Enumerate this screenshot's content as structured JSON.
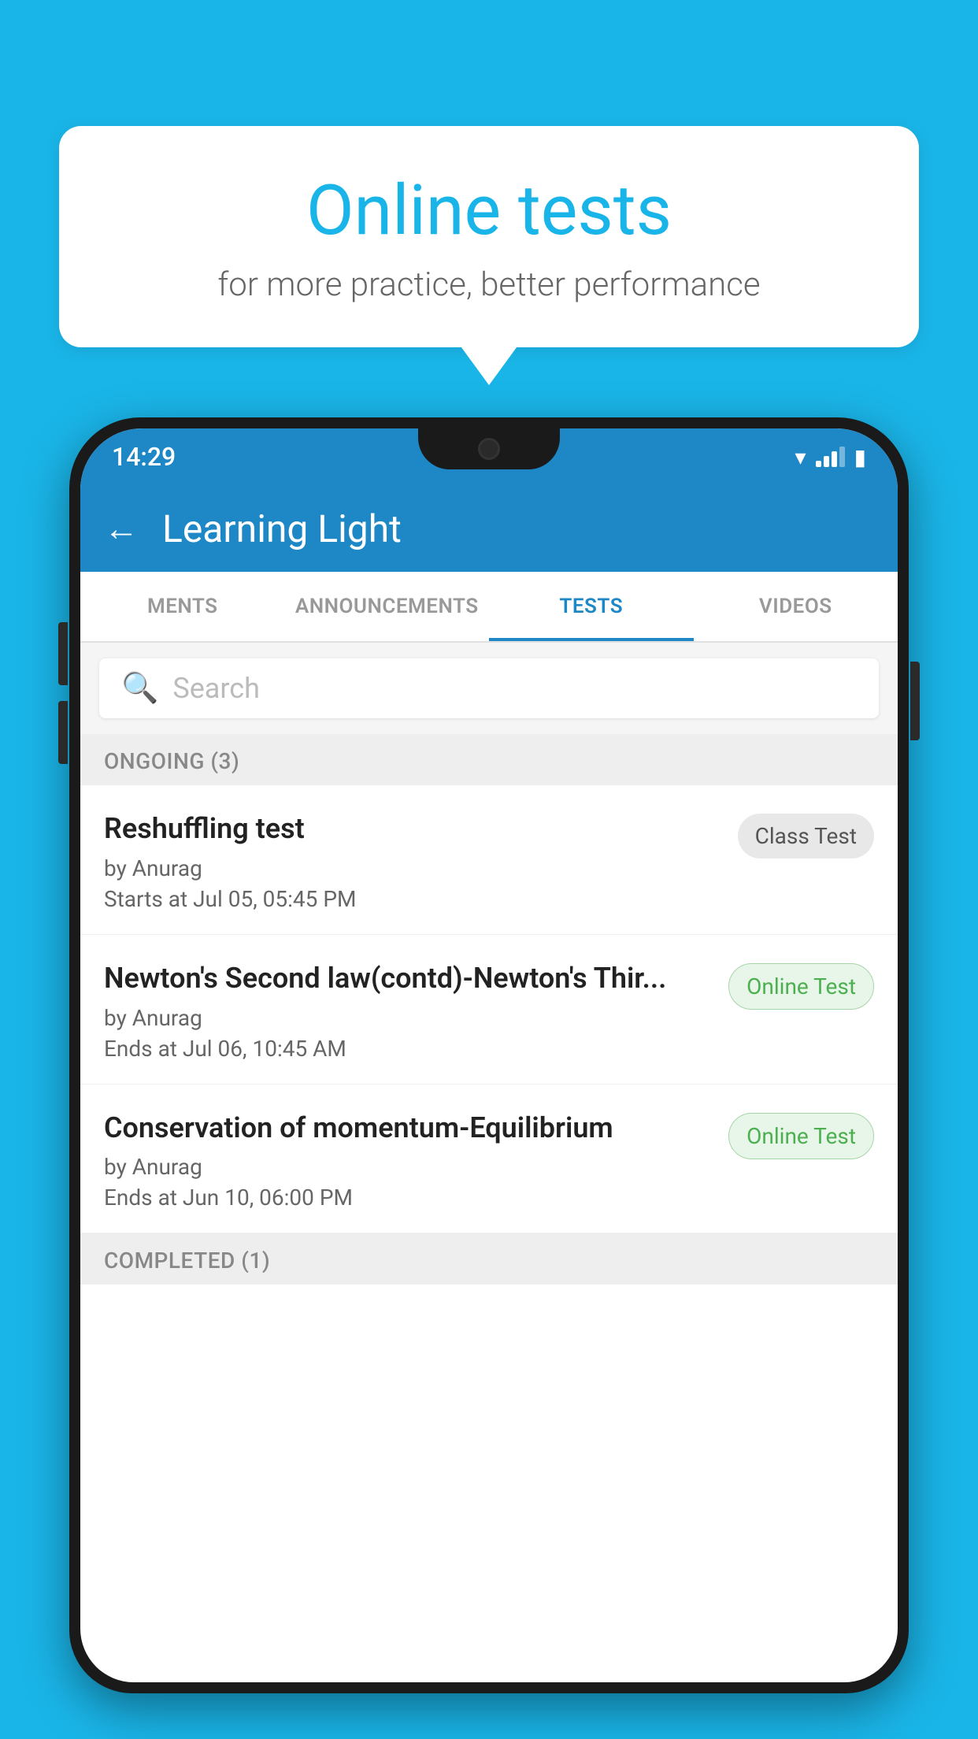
{
  "background_color": "#1ab5e8",
  "speech_bubble": {
    "title": "Online tests",
    "subtitle": "for more practice, better performance"
  },
  "phone": {
    "status_bar": {
      "time": "14:29"
    },
    "app_bar": {
      "title": "Learning Light",
      "back_label": "←"
    },
    "tabs": [
      {
        "label": "MENTS",
        "active": false
      },
      {
        "label": "ANNOUNCEMENTS",
        "active": false
      },
      {
        "label": "TESTS",
        "active": true
      },
      {
        "label": "VIDEOS",
        "active": false
      }
    ],
    "search": {
      "placeholder": "Search"
    },
    "ongoing_section": {
      "title": "ONGOING (3)"
    },
    "tests": [
      {
        "name": "Reshuffling test",
        "author": "by Anurag",
        "time_label": "Starts at",
        "time": "Jul 05, 05:45 PM",
        "badge": "Class Test",
        "badge_type": "class"
      },
      {
        "name": "Newton's Second law(contd)-Newton's Thir...",
        "author": "by Anurag",
        "time_label": "Ends at",
        "time": "Jul 06, 10:45 AM",
        "badge": "Online Test",
        "badge_type": "online"
      },
      {
        "name": "Conservation of momentum-Equilibrium",
        "author": "by Anurag",
        "time_label": "Ends at",
        "time": "Jun 10, 06:00 PM",
        "badge": "Online Test",
        "badge_type": "online"
      }
    ],
    "completed_section": {
      "title": "COMPLETED (1)"
    }
  }
}
